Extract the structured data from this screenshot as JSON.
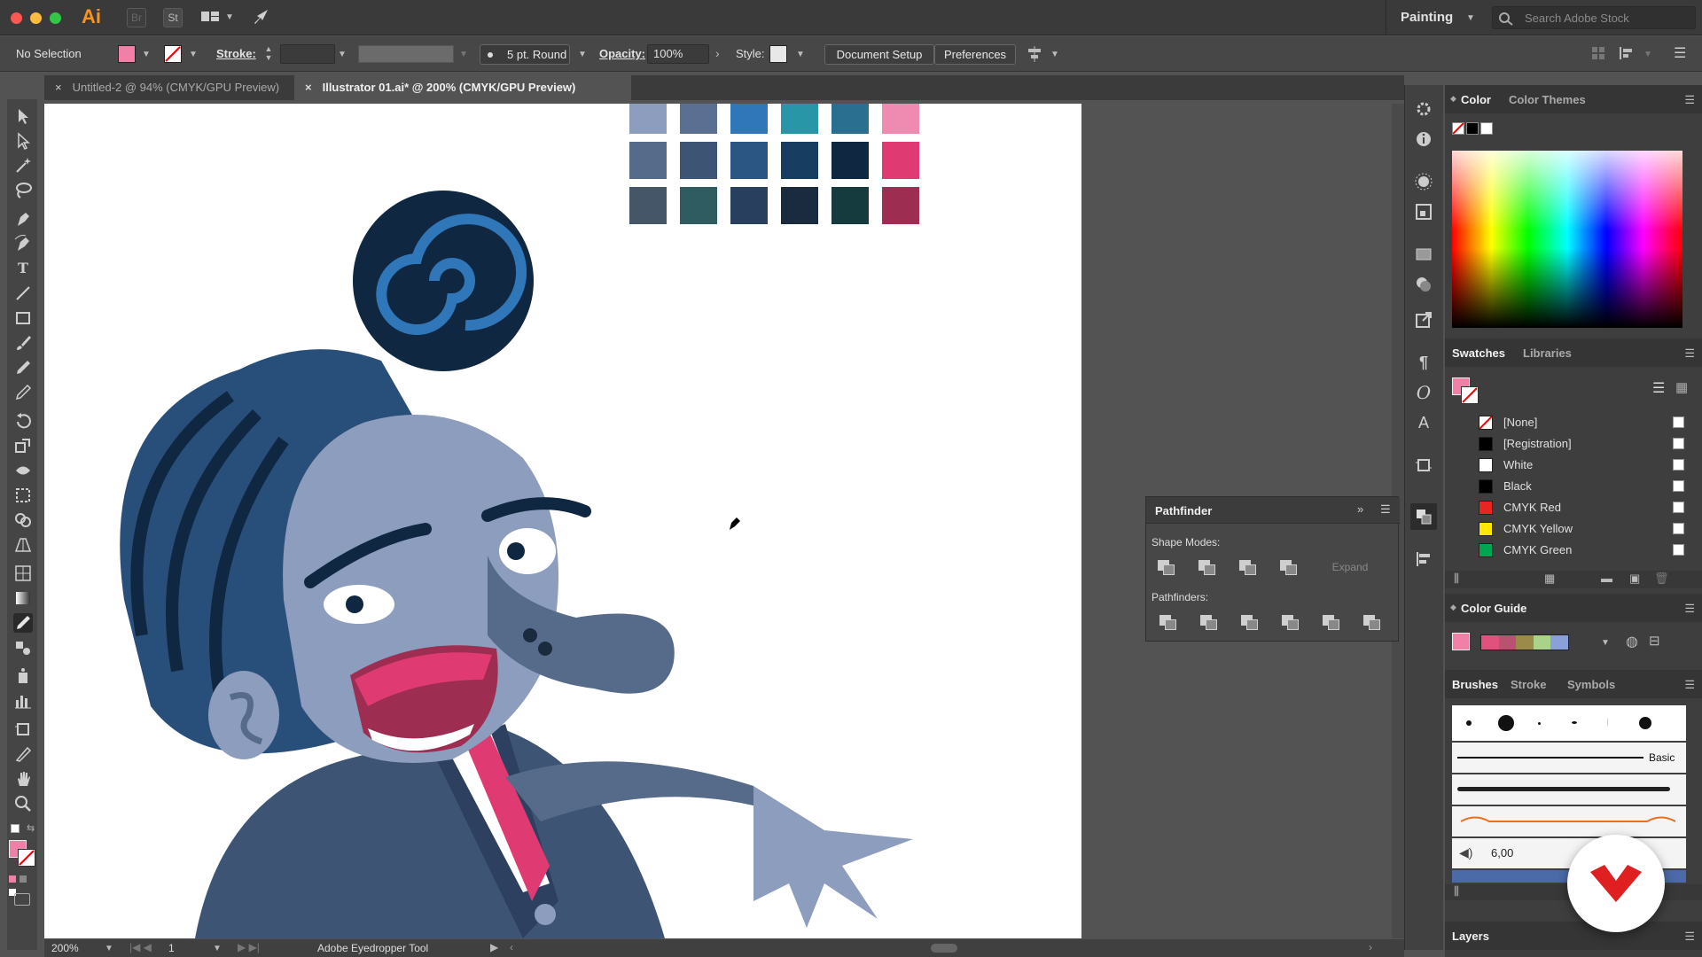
{
  "titlebar": {
    "app_logo": "Ai",
    "bridge": "Br",
    "stock": "St",
    "workspace": "Painting",
    "search_placeholder": "Search Adobe Stock"
  },
  "controlbar": {
    "selection": "No Selection",
    "stroke_label": "Stroke:",
    "brush": "5 pt. Round",
    "opacity_label": "Opacity:",
    "opacity_value": "100%",
    "style_label": "Style:",
    "document_setup": "Document Setup",
    "preferences": "Preferences",
    "fill_color": "#f080a8"
  },
  "tabs": [
    {
      "label": "Untitled-2 @ 94% (CMYK/GPU Preview)",
      "active": false
    },
    {
      "label": "Illustrator 01.ai* @ 200% (CMYK/GPU Preview)",
      "active": true
    }
  ],
  "palette": {
    "rows": [
      [
        "#8c9dbd",
        "#5b6f93",
        "#2f77b8",
        "#2896a6",
        "#2a6f8f",
        "#ef8ab0"
      ],
      [
        "#566a8a",
        "#3e5475",
        "#2b5583",
        "#173d60",
        "#0f2740",
        "#df3b72"
      ],
      [
        "#465669",
        "#2f5c60",
        "#283f5e",
        "#1a2b40",
        "#153b3f",
        "#9e2d52"
      ]
    ]
  },
  "pathfinder": {
    "title": "Pathfinder",
    "shape_modes_label": "Shape Modes:",
    "expand": "Expand",
    "pathfinders_label": "Pathfinders:"
  },
  "color_panel": {
    "tabs": [
      "Color",
      "Color Themes"
    ]
  },
  "swatches_panel": {
    "tabs": [
      "Swatches",
      "Libraries"
    ],
    "items": [
      {
        "name": "[None]",
        "color": "none"
      },
      {
        "name": "[Registration]",
        "color": "#000000"
      },
      {
        "name": "White",
        "color": "#ffffff"
      },
      {
        "name": "Black",
        "color": "#000000"
      },
      {
        "name": "CMYK Red",
        "color": "#e8251f"
      },
      {
        "name": "CMYK Yellow",
        "color": "#ffe800"
      },
      {
        "name": "CMYK Green",
        "color": "#00a552"
      }
    ]
  },
  "color_guide": {
    "title": "Color Guide",
    "harmony": [
      "#e0527e",
      "#b85270",
      "#9b8a4a",
      "#a9d38a",
      "#8aa0d8"
    ]
  },
  "brushes_panel": {
    "tabs": [
      "Brushes",
      "Stroke",
      "Symbols"
    ],
    "basic_label": "Basic",
    "size_value": "6,00"
  },
  "layers_panel": {
    "title": "Layers"
  },
  "statusbar": {
    "zoom": "200%",
    "artboard_number": "1",
    "tool_name": "Adobe Eyedropper Tool"
  }
}
